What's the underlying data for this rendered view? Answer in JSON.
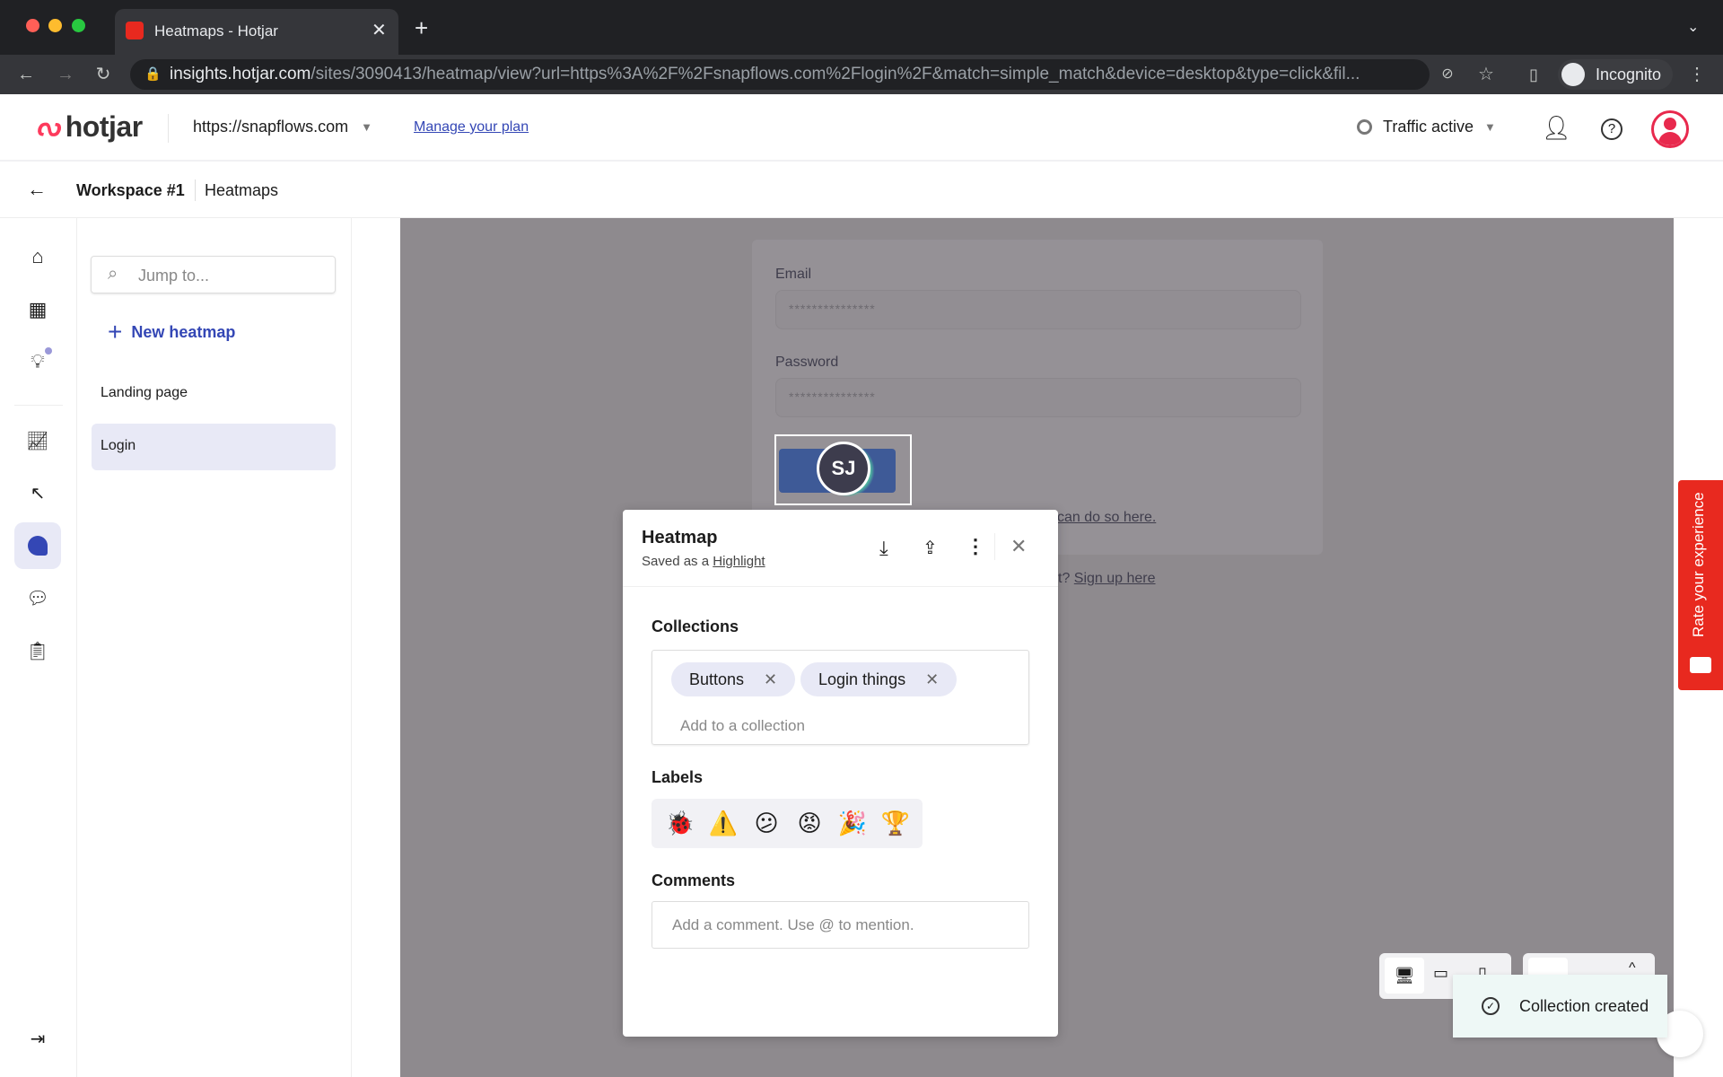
{
  "browser": {
    "tab_title": "Heatmaps - Hotjar",
    "url_host": "insights.hotjar.com",
    "url_path": "/sites/3090413/heatmap/view?url=https%3A%2F%2Fsnapflows.com%2Flogin%2F&match=simple_match&device=desktop&type=click&fil...",
    "profile": "Incognito"
  },
  "header": {
    "logo": "hotjar",
    "site": "https://snapflows.com",
    "manage_plan": "Manage your plan",
    "traffic": "Traffic active"
  },
  "breadcrumb": {
    "workspace": "Workspace #1",
    "section": "Heatmaps"
  },
  "sidebar": {
    "search_placeholder": "Jump to...",
    "new_heatmap": "New heatmap",
    "items": [
      {
        "label": "Landing page"
      },
      {
        "label": "Login"
      }
    ]
  },
  "page": {
    "email_label": "Email",
    "email_value": "***************",
    "password_label": "Password",
    "password_value": "***************",
    "avatar": "SJ",
    "link1": "can do so here.",
    "link2_prefix": "t?",
    "link2": "Sign up here"
  },
  "modal": {
    "title": "Heatmap",
    "saved_prefix": "Saved as a",
    "saved_link": "Highlight",
    "collections_label": "Collections",
    "collections": [
      "Buttons",
      "Login things"
    ],
    "collection_placeholder": "Add to a collection",
    "labels_label": "Labels",
    "labels": [
      "🐞",
      "⚠️",
      "😕",
      "😡",
      "🎉",
      "🏆"
    ],
    "comments_label": "Comments",
    "comment_placeholder": "Add a comment. Use @ to mention."
  },
  "feedback": {
    "label": "Rate your experience"
  },
  "toast": {
    "message": "Collection created"
  },
  "colors": {
    "brand": "#fd3a5c",
    "accent": "#3447b5",
    "feedback": "#e8291f",
    "overlay": "#8e8a8e"
  }
}
